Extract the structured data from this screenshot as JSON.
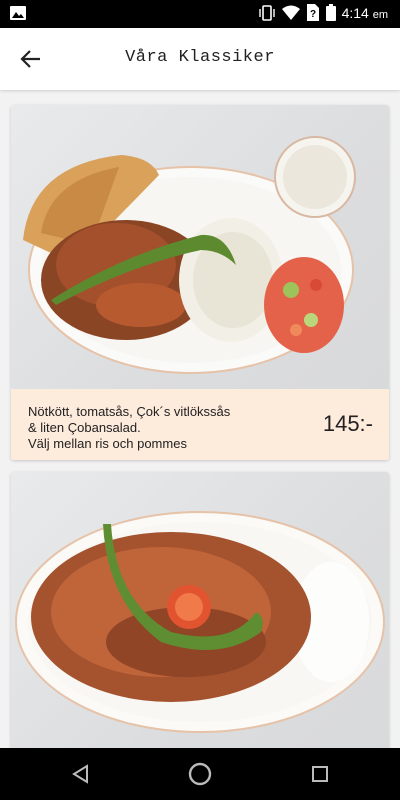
{
  "status_bar": {
    "time": "4:14",
    "ampm": "em",
    "icons": [
      "image-icon",
      "vibrate-icon",
      "wifi-icon",
      "no-sim-icon",
      "battery-icon"
    ]
  },
  "header": {
    "title": "Våra Klassiker",
    "back_icon": "arrow-left-icon"
  },
  "items": [
    {
      "description_lines": [
        "Nötkött, tomatsås, Çok´s vitlökssås",
        "& liten Çobansalad.",
        "Välj mellan ris och pommes"
      ],
      "price": "145:-"
    }
  ],
  "colors": {
    "description_bg": "#fdebdc",
    "app_bg": "#f2f2f2"
  },
  "navigation": {
    "icons": [
      "back-triangle-icon",
      "home-circle-icon",
      "recents-square-icon"
    ]
  }
}
